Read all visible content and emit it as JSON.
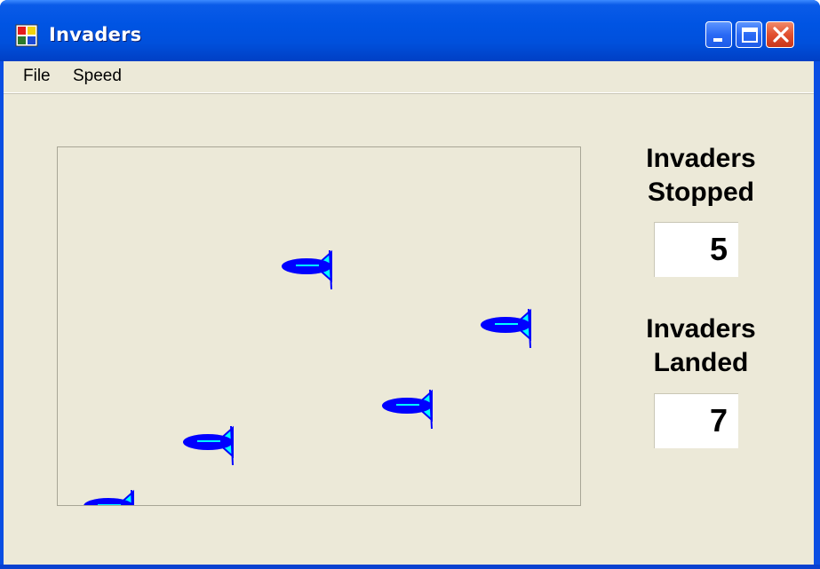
{
  "window": {
    "title": "Invaders",
    "icon": "app-icon"
  },
  "title_buttons": {
    "minimize": "minimize-icon",
    "maximize": "maximize-icon",
    "close": "close-icon"
  },
  "menu": {
    "items": [
      "File",
      "Speed"
    ]
  },
  "stats": {
    "stopped_label_line1": "Invaders",
    "stopped_label_line2": "Stopped",
    "stopped_value": "5",
    "landed_label_line1": "Invaders",
    "landed_label_line2": "Landed",
    "landed_value": "7"
  },
  "game": {
    "invader_icon": "invader-ship-icon",
    "invader_count_visible": 5
  },
  "colors": {
    "title_bar": "#0054e3",
    "window_bg": "#ece9d8",
    "ship_body": "#0000ff",
    "ship_fin": "#00ffff"
  }
}
